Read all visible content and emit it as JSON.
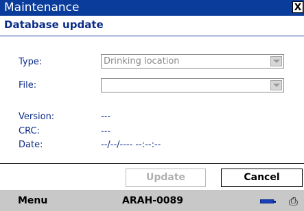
{
  "window": {
    "title": "Maintenance",
    "close_glyph": "X"
  },
  "page": {
    "subtitle": "Database update"
  },
  "form": {
    "type_label": "Type:",
    "type_value": "Drinking location",
    "file_label": "File:",
    "file_value": "",
    "version_label": "Version:",
    "version_value": "---",
    "crc_label": "CRC:",
    "crc_value": "---",
    "date_label": "Date:",
    "date_value": "--/--/---- --:--:--"
  },
  "buttons": {
    "update": "Update",
    "cancel": "Cancel"
  },
  "menubar": {
    "menu": "Menu",
    "device_id": "ARAH-0089",
    "battery_icon": "battery-icon",
    "printer_icon": "printer-icon"
  },
  "colors": {
    "titlebar": "#0a3c9c",
    "text": "#0a2c88",
    "disabled": "#b0b0b0"
  }
}
